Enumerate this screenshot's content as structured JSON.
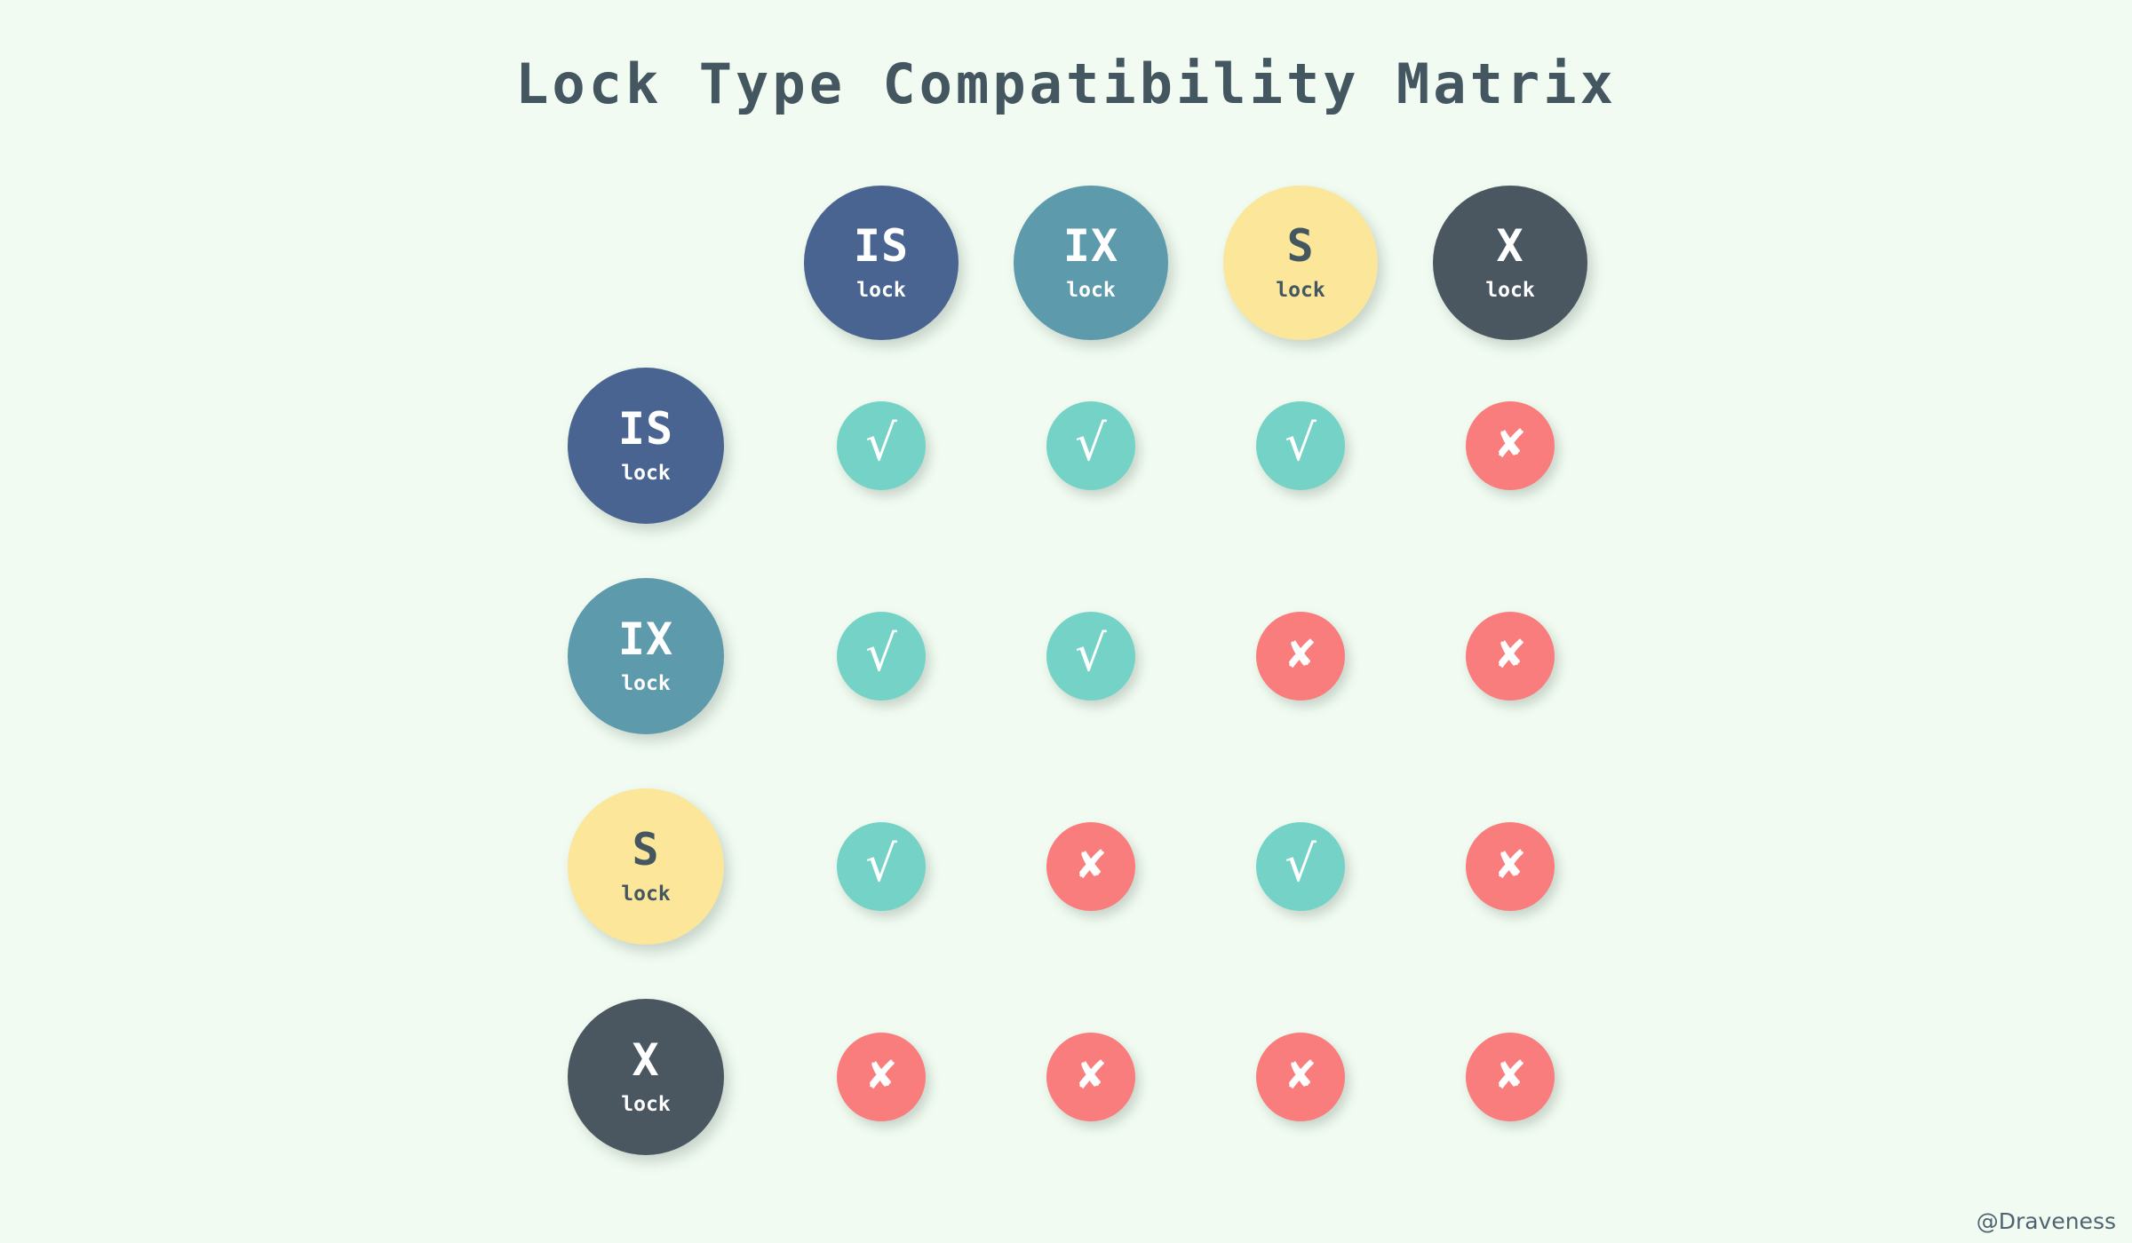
{
  "title": "Lock Type Compatibility Matrix",
  "watermark": "@Draveness",
  "colors": {
    "background": "#f1fbf1",
    "title_text": "#445761",
    "is_lock": "#4a6491",
    "ix_lock": "#5d9aab",
    "s_lock": "#fbe69a",
    "x_lock": "#4a5761",
    "compatible": "#74d3c6",
    "incompatible": "#fa7d7d",
    "chip_text_light": "#ffffff",
    "chip_text_dark": "#445761"
  },
  "lock_sub_label": "lock",
  "glyphs": {
    "compatible": "√",
    "incompatible": "✘"
  },
  "chart_data": {
    "type": "table",
    "title": "Lock Type Compatibility Matrix",
    "categories": [
      "IS",
      "IX",
      "S",
      "X"
    ],
    "column_headers": [
      {
        "code": "IS",
        "sub": "lock",
        "variant": "is"
      },
      {
        "code": "IX",
        "sub": "lock",
        "variant": "ix"
      },
      {
        "code": "S",
        "sub": "lock",
        "variant": "s"
      },
      {
        "code": "X",
        "sub": "lock",
        "variant": "x"
      }
    ],
    "row_headers": [
      {
        "code": "IS",
        "sub": "lock",
        "variant": "is"
      },
      {
        "code": "IX",
        "sub": "lock",
        "variant": "ix"
      },
      {
        "code": "S",
        "sub": "lock",
        "variant": "s"
      },
      {
        "code": "X",
        "sub": "lock",
        "variant": "x"
      }
    ],
    "rows": [
      {
        "row": "IS",
        "cells": [
          "yes",
          "yes",
          "yes",
          "no"
        ]
      },
      {
        "row": "IX",
        "cells": [
          "yes",
          "yes",
          "no",
          "no"
        ]
      },
      {
        "row": "S",
        "cells": [
          "yes",
          "no",
          "yes",
          "no"
        ]
      },
      {
        "row": "X",
        "cells": [
          "no",
          "no",
          "no",
          "no"
        ]
      }
    ],
    "legend": [
      {
        "symbol": "√",
        "meaning": "compatible"
      },
      {
        "symbol": "✘",
        "meaning": "incompatible"
      }
    ]
  }
}
